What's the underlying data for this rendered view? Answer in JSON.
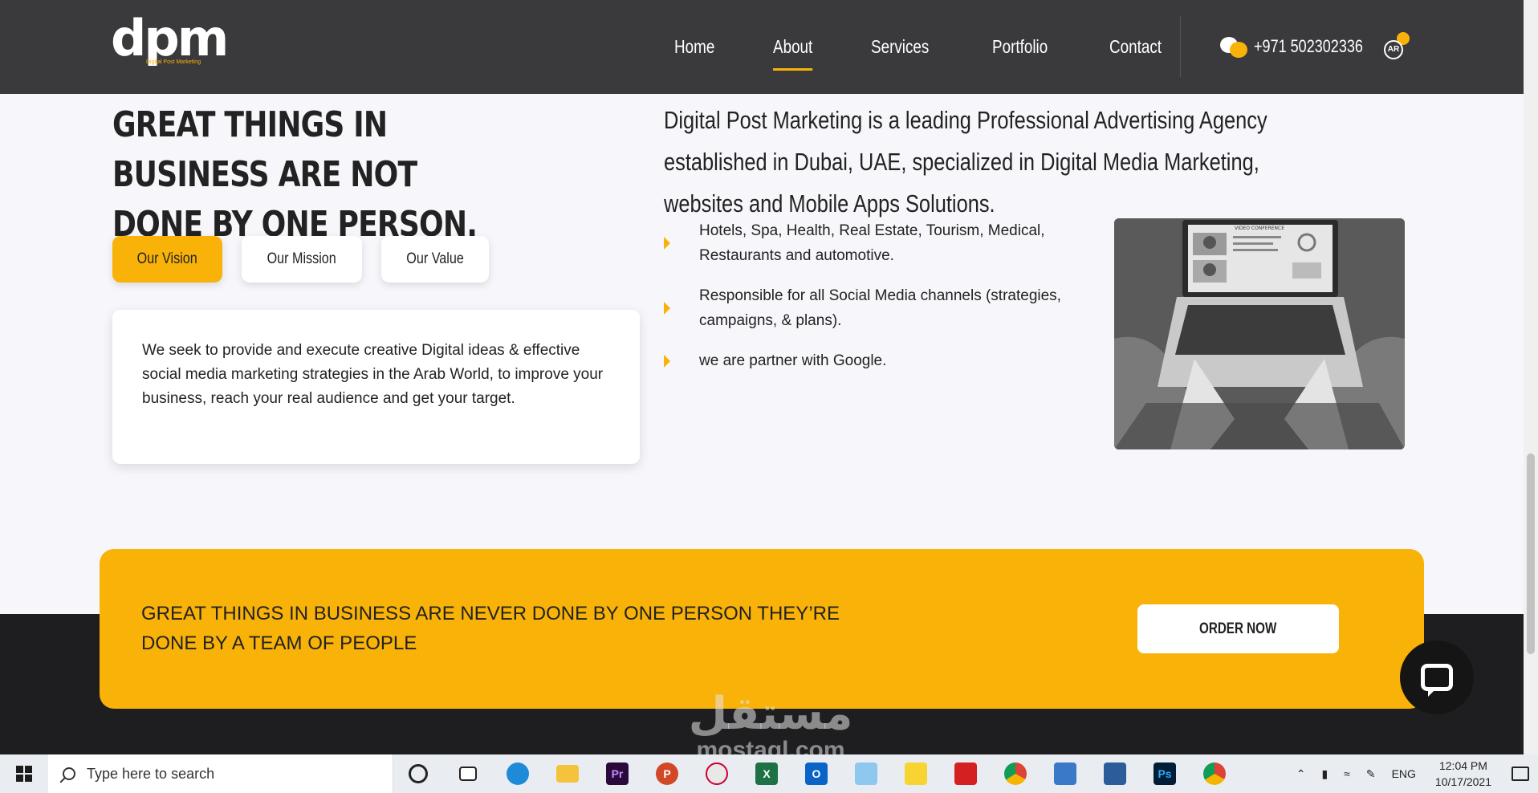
{
  "nav": {
    "logo_text": "dpm",
    "logo_tagline": "Digital Post Marketing",
    "links": [
      "Home",
      "About",
      "Services",
      "Portfolio",
      "Contact"
    ],
    "active_link": "About",
    "phone": "+971 502302336",
    "lang": "AR",
    "accent_color": "#f9b208"
  },
  "about": {
    "headline": "GREAT THINGS IN BUSINESS ARE NOT DONE BY ONE PERSON.",
    "tabs": [
      "Our Vision",
      "Our Mission",
      "Our Value"
    ],
    "active_tab": "Our Vision",
    "vision_text": "We seek to provide and execute creative Digital ideas & effective social media marketing strategies in the Arab World, to improve your business, reach your real audience and get your target.",
    "intro": "Digital Post Marketing is a leading Professional Advertising Agency established in Dubai, UAE, specialized in Digital Media Marketing, websites and Mobile Apps Solutions.",
    "features": [
      "Hotels, Spa, Health, Real Estate, Tourism, Medical, Restaurants and automotive.",
      "Responsible for all Social Media channels (strategies, campaigns, & plans).",
      "we are partner with Google."
    ],
    "image_screen_title": "VIDEO CONFERENCE"
  },
  "cta": {
    "text": "GREAT THINGS IN BUSINESS ARE NEVER DONE BY ONE PERSON THEY’RE DONE BY A TEAM OF PEOPLE",
    "button": "ORDER NOW"
  },
  "watermark": {
    "arabic": "مستقل",
    "latin": "mostaql.com"
  },
  "taskbar": {
    "search_placeholder": "Type here to search",
    "apps": [
      "cortana-icon",
      "task-view-icon",
      "edge-icon",
      "file-explorer-icon",
      "premiere-icon",
      "powerpoint-icon",
      "paint-icon",
      "excel-icon",
      "outlook-icon",
      "notepad-icon",
      "sticky-notes-icon",
      "acrobat-icon",
      "chrome-icon",
      "network-icon",
      "app-icon",
      "photoshop-icon",
      "chrome-icon-2"
    ],
    "lang": "ENG",
    "time": "12:04 PM",
    "date": "10/17/2021"
  }
}
